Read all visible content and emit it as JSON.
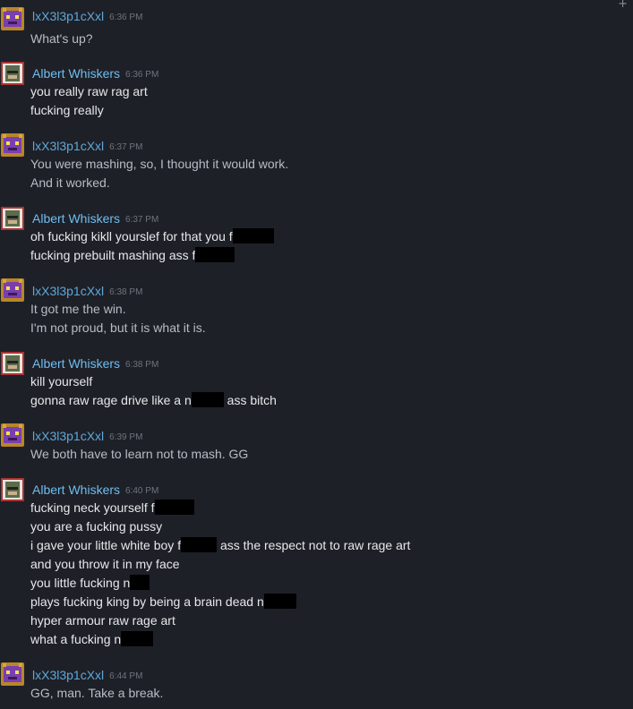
{
  "users": {
    "a": {
      "name": "lxX3l3p1cXxl"
    },
    "b": {
      "name": "Albert Whiskers"
    }
  },
  "colors": {
    "background": "#1e2027",
    "name_self": "#5ea8d9",
    "name_other": "#6fbdf0"
  },
  "messages": [
    {
      "time": "6:36 PM",
      "lines": [
        "What's up?"
      ]
    },
    {
      "time": "6:36 PM",
      "lines": [
        "you really raw rag art",
        "fucking really"
      ]
    },
    {
      "time": "6:37 PM",
      "lines": [
        "You were mashing, so, I thought it would work.",
        "And it worked."
      ]
    },
    {
      "time": "6:37 PM",
      "lines": [
        "oh fucking kikll yourslef for that you f",
        "fucking prebuilt mashing ass f"
      ]
    },
    {
      "time": "6:38 PM",
      "lines": [
        "It got me the win.",
        "I'm not proud, but it is what it is."
      ]
    },
    {
      "time": "6:38 PM",
      "lines": [
        "kill yourself",
        "gonna raw rage drive like a n",
        " ass bitch"
      ]
    },
    {
      "time": "6:39 PM",
      "lines": [
        "We both have to learn not to mash. GG"
      ]
    },
    {
      "time": "6:40 PM",
      "lines": [
        "fucking neck yourself f",
        "you are a fucking pussy",
        "i gave your little white boy f",
        " ass the respect not to raw rage art",
        "and you throw it in my face",
        "you little fucking n",
        "plays fucking king by being a brain dead n",
        "hyper armour raw rage art",
        "what a fucking n"
      ]
    },
    {
      "time": "6:44 PM",
      "lines": [
        "GG, man. Take a break."
      ]
    }
  ]
}
